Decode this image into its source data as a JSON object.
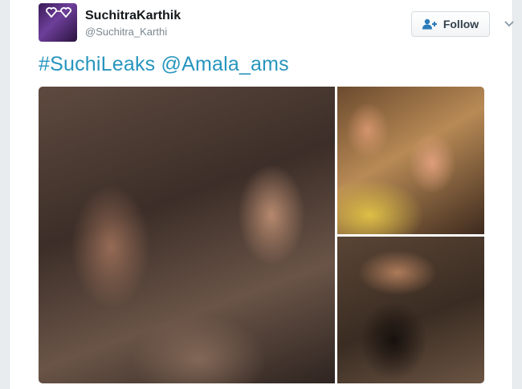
{
  "tweet": {
    "display_name": "SuchitraKarthik",
    "handle": "@Suchitra_Karthi",
    "follow_label": "Follow",
    "text": "#SuchiLeaks @Amala_ams"
  },
  "icons": {
    "avatar": "avatar",
    "follow": "add-user-icon",
    "menu": "chevron-down-icon"
  },
  "colors": {
    "hashtag": "#2795be",
    "name": "#14171a",
    "handle": "#7b8790",
    "follow_text": "#33414c"
  }
}
